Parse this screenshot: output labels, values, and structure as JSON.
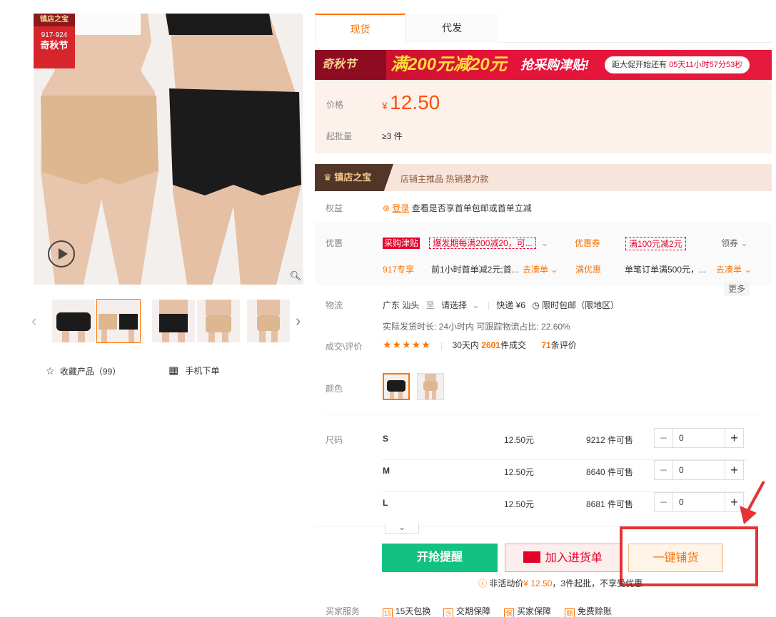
{
  "gallery": {
    "badge_top": "镇店之宝",
    "badge_date": "917·924",
    "badge_name": "奇秋节",
    "thumb_count": 5,
    "fav_label": "收藏产品（99）",
    "mobile_label": "手机下单"
  },
  "tabs": [
    {
      "label": "现货"
    },
    {
      "label": "代发"
    }
  ],
  "banner": {
    "logo": "奇秋节",
    "main": "满200元减20元",
    "sub": "抢采购津贴!",
    "countdown_prefix": "距大促开始还有",
    "countdown_time": "05天11小时57分53秒"
  },
  "price": {
    "label": "价格",
    "currency": "¥",
    "value": "12.50",
    "moq_label": "起批量",
    "moq": "≥3 件"
  },
  "treasure": {
    "tag": "镇店之宝",
    "text": "店铺主推品  热销潜力款"
  },
  "rights": {
    "label": "权益",
    "login": "登录",
    "text": "查看是否享首单包邮或首单立减"
  },
  "discount": {
    "label": "优惠",
    "tag1": "采购津贴",
    "coupon1": "爆发期每满200减20，可...",
    "coupon_label": "优惠券",
    "coupon2": "满100元减2元",
    "claim": "领券",
    "vip": "917专享",
    "vip_text": "前1小时首单减2元;首...",
    "go1": "去凑单",
    "youhui": "满优惠",
    "youhui_text": "单笔订单满500元，...",
    "go2": "去凑单",
    "more": "更多"
  },
  "logistics": {
    "label": "物流",
    "from": "广东 汕头",
    "to_word": "至",
    "to": "请选择",
    "express": "快递 ¥6",
    "free": "限时包邮（限地区）",
    "ship_time": "实际发货时长: 24小时内  可跟踪物流占比: 22.60%"
  },
  "reviews": {
    "label": "成交\\评价",
    "stars": "★★★★★",
    "deals_prefix": "30天内",
    "deals": "2601",
    "deals_suffix": "件成交",
    "reviews": "71",
    "reviews_suffix": "条评价"
  },
  "color": {
    "label": "颜色"
  },
  "sizes": {
    "label": "尺码",
    "rows": [
      {
        "size": "S",
        "price": "12.50元",
        "stock": "9212 件可售",
        "qty": "0"
      },
      {
        "size": "M",
        "price": "12.50元",
        "stock": "8640 件可售",
        "qty": "0"
      },
      {
        "size": "L",
        "price": "12.50元",
        "stock": "8681 件可售",
        "qty": "0"
      }
    ]
  },
  "actions": {
    "remind": "开抢提醒",
    "cart": "加入进货单",
    "distribute": "一键铺货",
    "note_prefix": "非活动价",
    "note_price": "¥ 12.50",
    "note_suffix": "，3件起批，不享受优惠"
  },
  "services": {
    "label": "买家服务",
    "items": [
      "15天包换",
      "交期保障",
      "买家保障",
      "免费赊账"
    ]
  },
  "colors": {
    "accent": "#ff7300",
    "red": "#e4002b",
    "green": "#13c282"
  }
}
